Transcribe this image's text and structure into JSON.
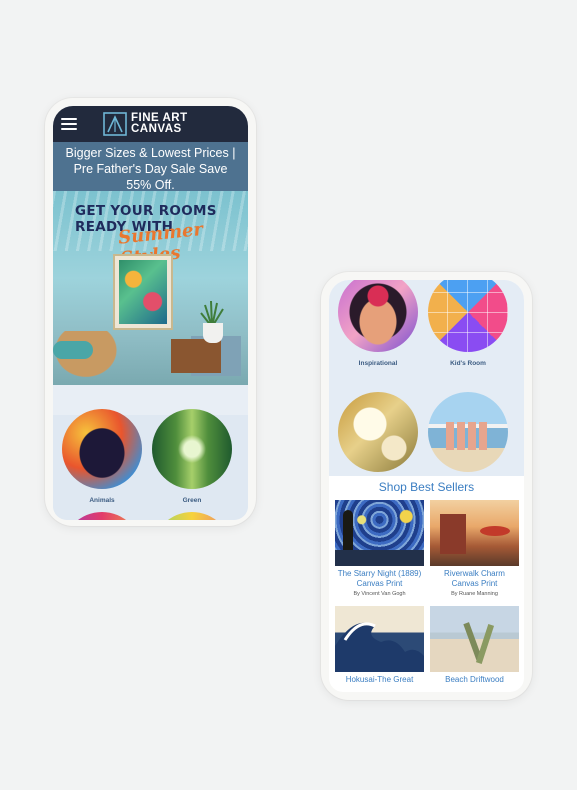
{
  "phone1": {
    "logo": {
      "line1": "FINE ART",
      "line2": "CANVAS"
    },
    "promo_text": "Bigger Sizes & Lowest Prices | Pre Father's Day Sale Save 55% Off.",
    "hero": {
      "headline_line1": "GET YOUR ROOMS",
      "headline_line2": "READY WITH",
      "script": "Summer Styles"
    },
    "categories": [
      {
        "label": "Animals"
      },
      {
        "label": "Green"
      }
    ]
  },
  "phone2": {
    "categories": [
      {
        "label": "Inspirational"
      },
      {
        "label": "Kid's Room"
      }
    ],
    "section_title": "Shop Best Sellers",
    "products": [
      {
        "name": "The Starry Night (1889) Canvas Print",
        "artist": "By Vincent Van Gogh"
      },
      {
        "name": "Riverwalk Charm Canvas Print",
        "artist": "By Ruane Manning"
      },
      {
        "name": "Hokusai-The Great",
        "artist": ""
      },
      {
        "name": "Beach Driftwood",
        "artist": ""
      }
    ]
  },
  "colors": {
    "background": "#f2f3f3",
    "nav": "#222a3d",
    "promo": "#4e7290",
    "accent": "#3b7ec2",
    "category_label": "#3c5c82"
  }
}
